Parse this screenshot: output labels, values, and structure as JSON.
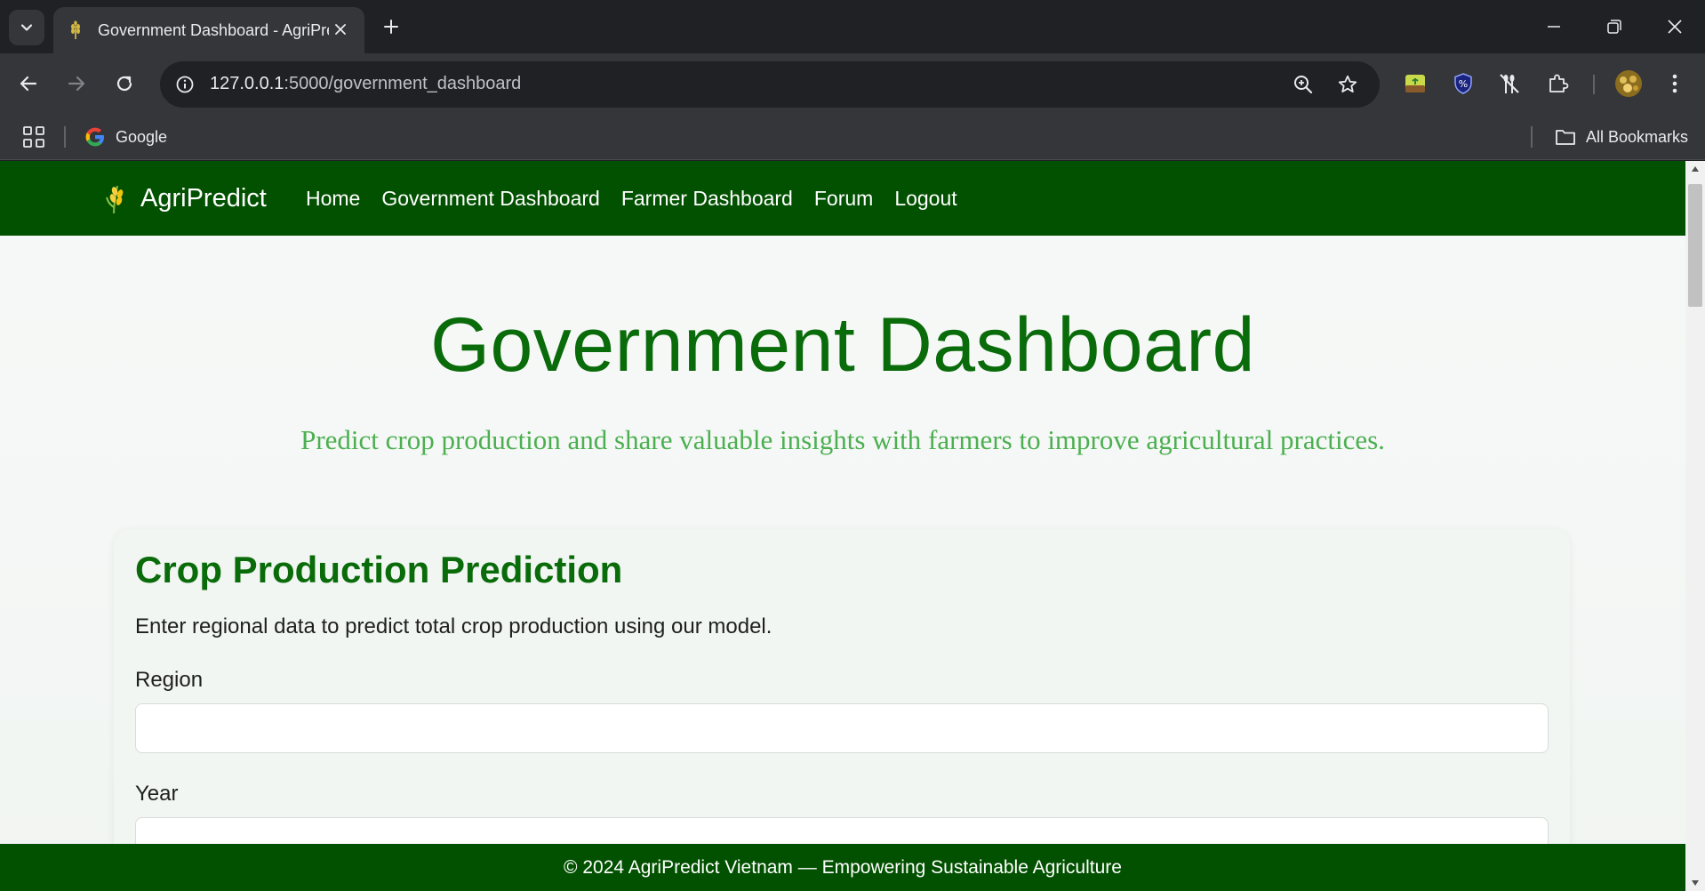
{
  "browser": {
    "tab_title": "Government Dashboard - AgriPredict",
    "url_host": "127.0.0.1",
    "url_path": ":5000/government_dashboard",
    "bookmarks": {
      "google_label": "Google",
      "all_bookmarks_label": "All Bookmarks"
    }
  },
  "site": {
    "brand": "AgriPredict",
    "nav": {
      "home": "Home",
      "government_dashboard": "Government Dashboard",
      "farmer_dashboard": "Farmer Dashboard",
      "forum": "Forum",
      "logout": "Logout"
    },
    "hero": {
      "title": "Government Dashboard",
      "subtitle": "Predict crop production and share valuable insights with farmers to improve agricultural practices."
    },
    "prediction_card": {
      "title": "Crop Production Prediction",
      "description": "Enter regional data to predict total crop production using our model.",
      "region_label": "Region",
      "region_value": "",
      "year_label": "Year",
      "year_value": ""
    },
    "footer": "© 2024 AgriPredict Vietnam — Empowering Sustainable Agriculture"
  },
  "colors": {
    "nav_bg": "#025100",
    "title_green": "#0a6b0a",
    "subtitle_green": "#4caf50"
  }
}
